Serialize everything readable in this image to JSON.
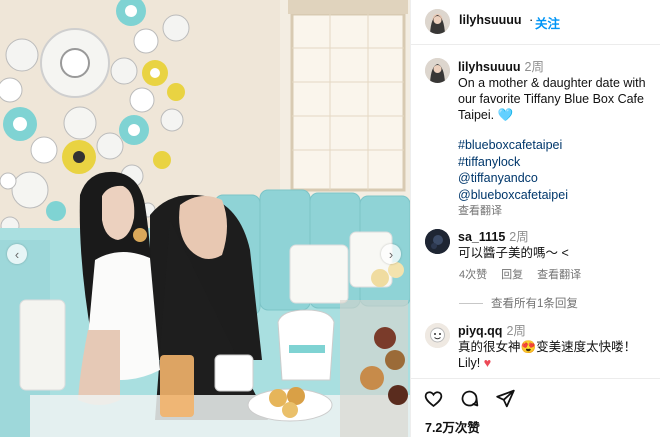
{
  "post": {
    "username": "lilyhsuuuu",
    "follow_dot": "·",
    "follow_label": "关注",
    "caption": {
      "username": "lilyhsuuuu",
      "time": "2周",
      "text": "On a mother & daughter date with our favorite Tiffany Blue Box Cafe Taipei. 🩵",
      "hashtags": [
        "#blueboxcafetaipei",
        "#tiffanylock",
        "@tiffanyandco",
        "@blueboxcafetaipei"
      ],
      "translate": "查看翻译"
    },
    "comments": [
      {
        "username": "sa_1115",
        "time": "2周",
        "text": "可以醬子美的嗎～ <",
        "likes": "4次赞",
        "reply": "回复",
        "translate": "查看翻译",
        "view_replies": "查看所有1条回复"
      },
      {
        "username": "piyq.qq",
        "time": "2周",
        "text_a": "真的很女神",
        "emoji": "😍",
        "text_b": "变美速度太快喽！",
        "text_c": "Lily!",
        "heart": "♥"
      }
    ],
    "likes_count": "7.2万次赞"
  },
  "colors": {
    "accent": "#0095f6",
    "tiffany_blue": "#81d8d0",
    "like_red": "#ed4956"
  },
  "icons": [
    "heart-icon",
    "comment-icon",
    "share-icon",
    "chevron-left-icon",
    "chevron-right-icon"
  ]
}
